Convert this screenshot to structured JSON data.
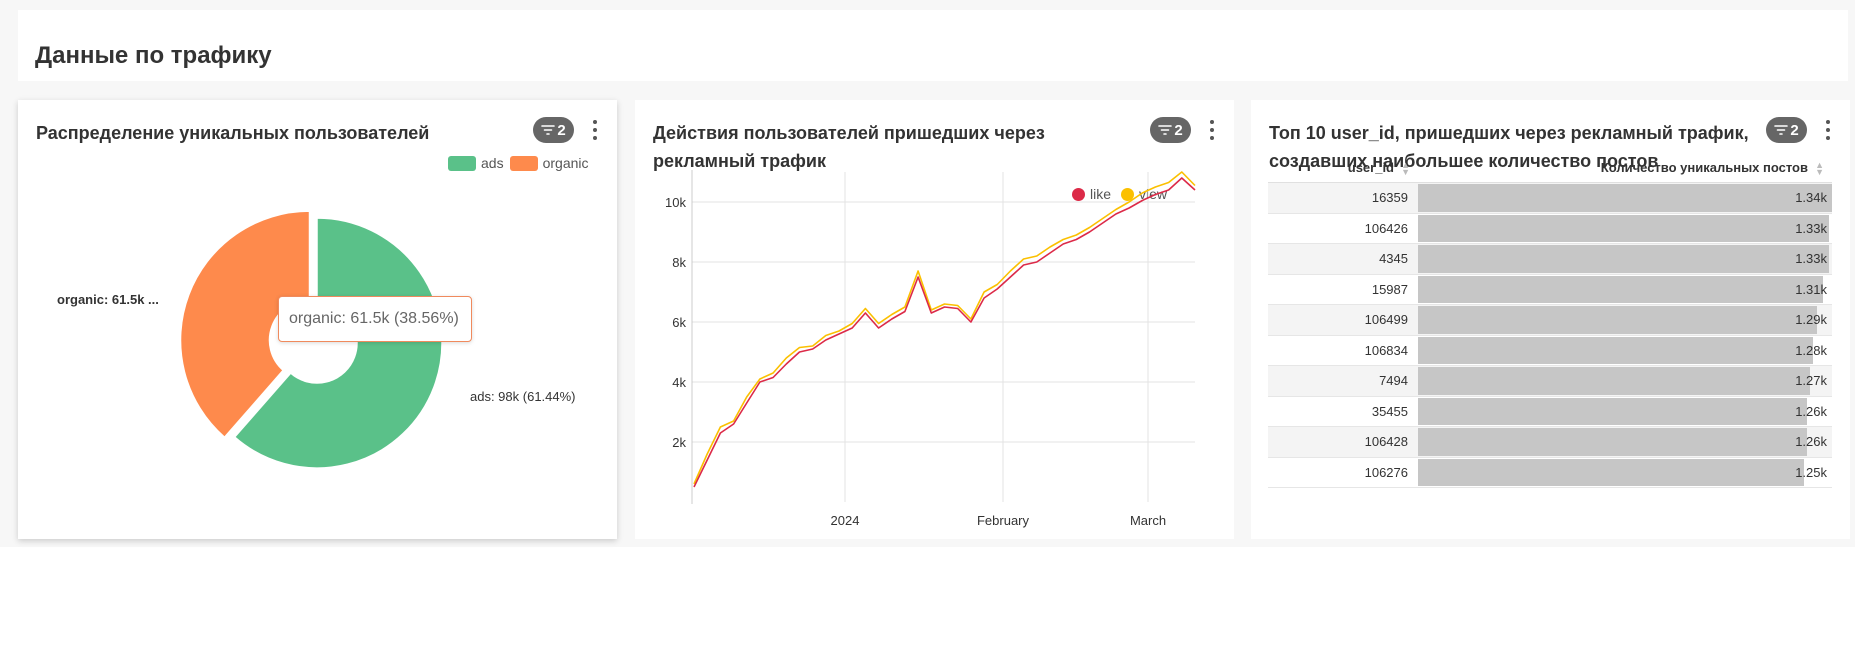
{
  "dashboard": {
    "title": "Данные по трафику"
  },
  "colors": {
    "ads": "#5ac189",
    "organic": "#fe8a4c",
    "like": "#dc2a48",
    "view": "#fbc000",
    "bar": "#c6c6c6"
  },
  "pie_card": {
    "title": "Распределение уникальных пользователей",
    "filter_count": "2",
    "filter_icon": "filter-icon",
    "menu_icon": "kebab-menu-icon",
    "legend": [
      "ads",
      "organic"
    ],
    "label_organic": "organic: 61.5k ...",
    "label_ads": "ads: 98k (61.44%)",
    "tooltip": "organic: 61.5k (38.56%)"
  },
  "line_card": {
    "title": "Действия пользователей пришедших через рекламный трафик",
    "filter_count": "2",
    "legend": [
      "like",
      "view"
    ],
    "y_ticks": [
      "10k",
      "8k",
      "6k",
      "4k",
      "2k"
    ],
    "x_ticks": [
      "2024",
      "February",
      "March"
    ]
  },
  "table_card": {
    "title": "Топ 10 user_id, пришедших через рекламный трафик, создавших наибольшее количество постов",
    "filter_count": "2",
    "col_user": "user_id",
    "col_posts": "Количество уникальных постов",
    "sort_icon": "sort-icon"
  },
  "chart_data": [
    {
      "type": "pie",
      "categories": [
        "ads",
        "organic"
      ],
      "values": [
        98000,
        61500
      ],
      "percentages": [
        61.44,
        38.56
      ],
      "legend": "top-right"
    },
    {
      "type": "line",
      "x_ticks": [
        "2024",
        "February",
        "March"
      ],
      "ylim": [
        0,
        11000
      ],
      "legend": "top-right",
      "grid": true,
      "series": [
        {
          "name": "like",
          "values": [
            500,
            1400,
            2300,
            2600,
            3300,
            4000,
            4150,
            4600,
            5000,
            5100,
            5400,
            5600,
            5800,
            6300,
            5800,
            6100,
            6350,
            7500,
            6300,
            6500,
            6450,
            6000,
            6800,
            7100,
            7500,
            7900,
            8000,
            8300,
            8600,
            8750,
            9000,
            9300,
            9600,
            9800,
            10050,
            10250,
            10400,
            10800,
            10400
          ]
        },
        {
          "name": "view",
          "values": [
            600,
            1600,
            2500,
            2700,
            3500,
            4100,
            4300,
            4800,
            5150,
            5200,
            5550,
            5700,
            5950,
            6450,
            5950,
            6250,
            6500,
            7700,
            6400,
            6600,
            6550,
            6100,
            7000,
            7250,
            7700,
            8100,
            8200,
            8500,
            8750,
            8900,
            9150,
            9450,
            9750,
            10000,
            10300,
            10500,
            10650,
            11000,
            10550
          ]
        }
      ]
    },
    {
      "type": "table",
      "columns": [
        "user_id",
        "Количество уникальных постов"
      ],
      "rows": [
        {
          "user_id": "16359",
          "posts": 1340,
          "label": "1.34k"
        },
        {
          "user_id": "106426",
          "posts": 1330,
          "label": "1.33k"
        },
        {
          "user_id": "4345",
          "posts": 1330,
          "label": "1.33k"
        },
        {
          "user_id": "15987",
          "posts": 1310,
          "label": "1.31k"
        },
        {
          "user_id": "106499",
          "posts": 1290,
          "label": "1.29k"
        },
        {
          "user_id": "106834",
          "posts": 1280,
          "label": "1.28k"
        },
        {
          "user_id": "7494",
          "posts": 1270,
          "label": "1.27k"
        },
        {
          "user_id": "35455",
          "posts": 1260,
          "label": "1.26k"
        },
        {
          "user_id": "106428",
          "posts": 1260,
          "label": "1.26k"
        },
        {
          "user_id": "106276",
          "posts": 1250,
          "label": "1.25k"
        }
      ]
    }
  ]
}
